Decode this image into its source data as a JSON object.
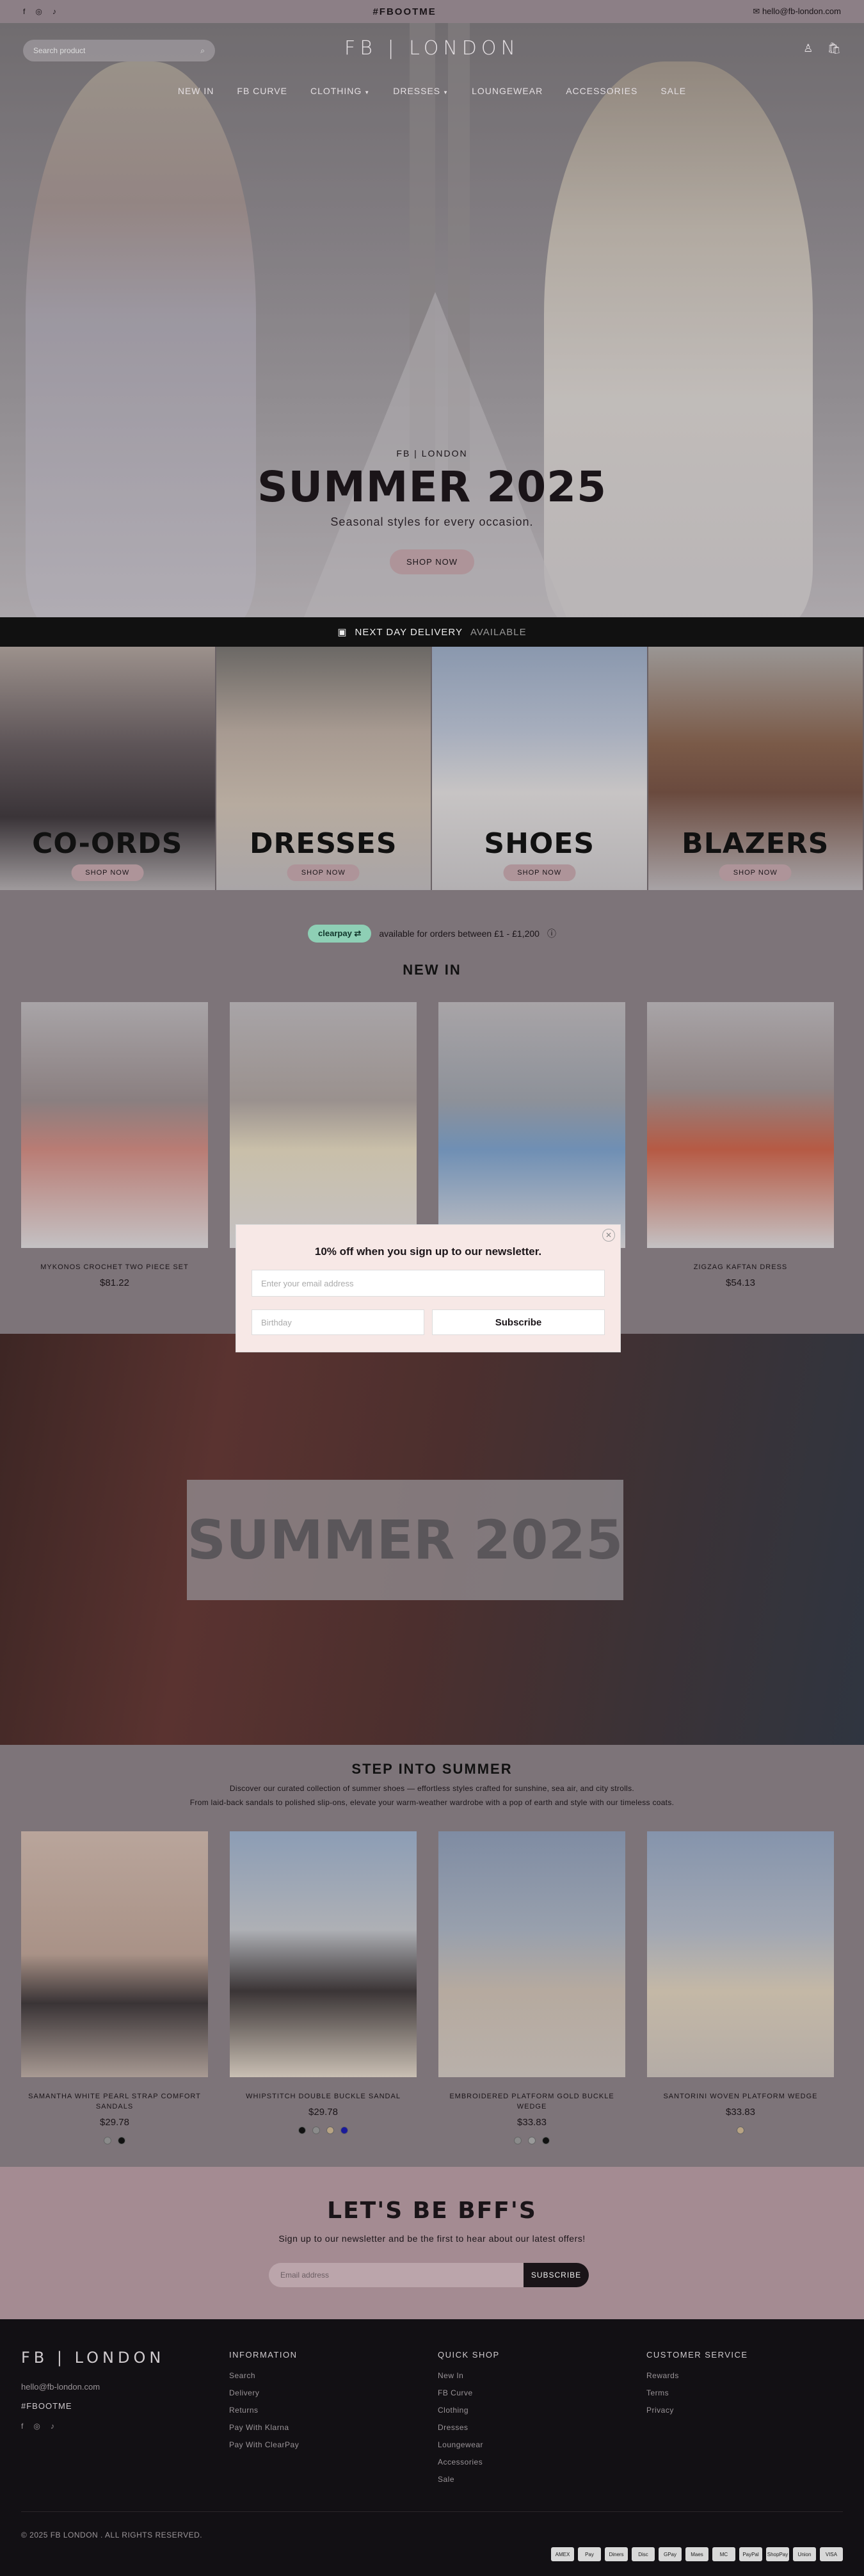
{
  "topbar": {
    "hashtag": "#FBOOTME",
    "email": "hello@fb-london.com"
  },
  "header": {
    "logo": "FB | LONDON",
    "search_placeholder": "Search product",
    "cart_count": "0"
  },
  "nav": [
    {
      "label": "NEW IN",
      "dropdown": false
    },
    {
      "label": "FB CURVE",
      "dropdown": false
    },
    {
      "label": "CLOTHING",
      "dropdown": true
    },
    {
      "label": "DRESSES",
      "dropdown": true
    },
    {
      "label": "LOUNGEWEAR",
      "dropdown": false
    },
    {
      "label": "ACCESSORIES",
      "dropdown": false
    },
    {
      "label": "SALE",
      "dropdown": false
    }
  ],
  "hero": {
    "brand": "FB | LONDON",
    "title": "SUMMER 2025",
    "subtitle": "Seasonal styles for every occasion.",
    "button": "SHOP NOW"
  },
  "delivery": {
    "label": "NEXT DAY DELIVERY",
    "status": "AVAILABLE"
  },
  "categories": [
    {
      "title": "CO-ORDS",
      "button": "SHOP NOW",
      "color": "#6f6469"
    },
    {
      "title": "DRESSES",
      "button": "SHOP NOW",
      "color": "#8d8286"
    },
    {
      "title": "SHOES",
      "button": "SHOP NOW",
      "color": "#93918f"
    },
    {
      "title": "BLAZERS",
      "button": "SHOP NOW",
      "color": "#7f7478"
    }
  ],
  "clearpay": {
    "badge": "clearpay",
    "text": "available for orders between £1 - £1,200"
  },
  "new_in": {
    "title": "NEW IN",
    "products": [
      {
        "name": "MYKONOS CROCHET TWO PIECE SET",
        "price": "$81.22"
      },
      {
        "name": "",
        "price": ""
      },
      {
        "name": "",
        "price": ""
      },
      {
        "name": "ZIGZAG KAFTAN DRESS",
        "price": "$54.13"
      }
    ]
  },
  "popup": {
    "title": "10% off when you sign up to our newsletter.",
    "email_placeholder": "Enter your email address",
    "birthday_placeholder": "Birthday",
    "button": "Subscribe"
  },
  "banner2": {
    "title": "SUMMER 2025"
  },
  "summer": {
    "title": "STEP INTO SUMMER",
    "intro_1": "Discover our curated collection of summer shoes — effortless styles crafted for sunshine, sea air, and city strolls.",
    "intro_2": "From laid-back sandals to polished slip-ons, elevate your warm-weather wardrobe with a pop of earth and style with our timeless coats.",
    "products": [
      {
        "name": "SAMANTHA WHITE PEARL STRAP COMFORT SANDALS",
        "price": "$29.78",
        "swatches": [
          "#8a8a8a",
          "#111111"
        ]
      },
      {
        "name": "WHIPSTITCH DOUBLE BUCKLE SANDAL",
        "price": "$29.78",
        "swatches": [
          "#111111",
          "#8a8a8a",
          "#b8a383",
          "#1a1a9a"
        ]
      },
      {
        "name": "EMBROIDERED PLATFORM GOLD BUCKLE WEDGE",
        "price": "$33.83",
        "swatches": [
          "#8a8a8a",
          "#9a9a9a",
          "#111111"
        ]
      },
      {
        "name": "SANTORINI WOVEN PLATFORM WEDGE",
        "price": "$33.83",
        "swatches": [
          "#b8a383"
        ]
      }
    ]
  },
  "bff": {
    "title": "LET'S BE BFF'S",
    "text": "Sign up to our newsletter and be the first to hear about our latest offers!",
    "placeholder": "Email address",
    "button": "SUBSCRIBE"
  },
  "footer": {
    "logo": "FB | LONDON",
    "email": "hello@fb-london.com",
    "tag": "#FBOOTME",
    "information": {
      "title": "INFORMATION",
      "links": [
        "Search",
        "Delivery",
        "Returns",
        "Pay With Klarna",
        "Pay With ClearPay"
      ]
    },
    "quick_shop": {
      "title": "QUICK SHOP",
      "links": [
        "New In",
        "FB Curve",
        "Clothing",
        "Dresses",
        "Loungewear",
        "Accessories",
        "Sale"
      ]
    },
    "customer_service": {
      "title": "CUSTOMER SERVICE",
      "links": [
        "Rewards",
        "Terms",
        "Privacy"
      ]
    },
    "copyright": "© 2025 FB LONDON . ALL RIGHTS RESERVED.",
    "payments": [
      "AMEX",
      "Pay",
      "Diners",
      "Disc",
      "GPay",
      "Maes",
      "MC",
      "PayPal",
      "ShopPay",
      "Union",
      "VISA"
    ]
  }
}
